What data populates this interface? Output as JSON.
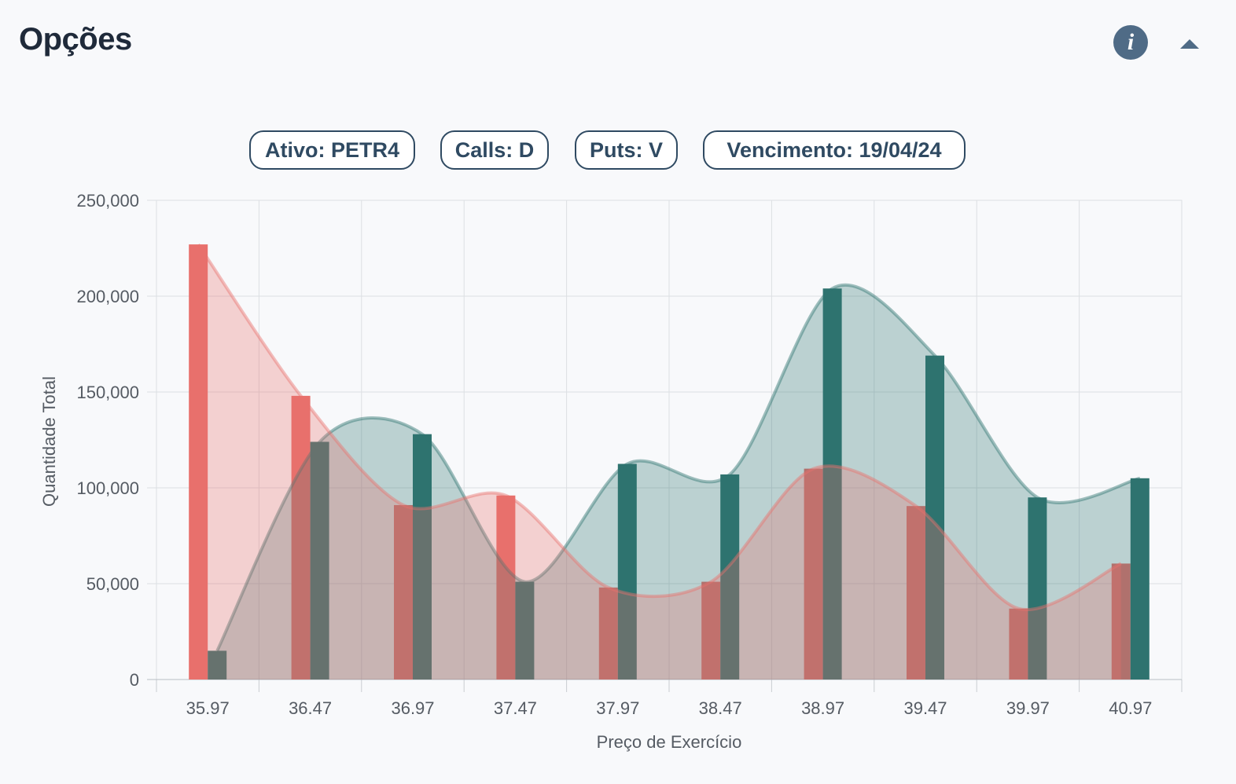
{
  "header": {
    "title": "Opções",
    "info_icon": "info-icon",
    "collapse_icon": "caret-up-icon"
  },
  "filters": [
    {
      "label": "Ativo: PETR4"
    },
    {
      "label": "Calls: D"
    },
    {
      "label": "Puts: V"
    },
    {
      "label": "Vencimento: 19/04/24"
    }
  ],
  "colors": {
    "calls": "#e8706c",
    "puts": "#2f736f",
    "accent": "#4f6b86"
  },
  "chart_data": {
    "type": "bar",
    "xlabel": "Preço de Exercício",
    "ylabel": "Quantidade Total",
    "ylim": [
      0,
      250000
    ],
    "yticks": [
      "0",
      "50,000",
      "100,000",
      "150,000",
      "200,000",
      "250,000"
    ],
    "categories": [
      "35.97",
      "36.47",
      "36.97",
      "37.47",
      "37.97",
      "38.47",
      "38.97",
      "39.47",
      "39.97",
      "40.97"
    ],
    "series": [
      {
        "values": [
          227000,
          148000,
          91000,
          96000,
          48000,
          51000,
          110000,
          90500,
          37000,
          60500
        ]
      },
      {
        "values": [
          15000,
          124000,
          128000,
          51000,
          112500,
          107000,
          204000,
          169000,
          95000,
          105000
        ]
      }
    ],
    "grid": true,
    "overlay": "smoothed-area"
  }
}
